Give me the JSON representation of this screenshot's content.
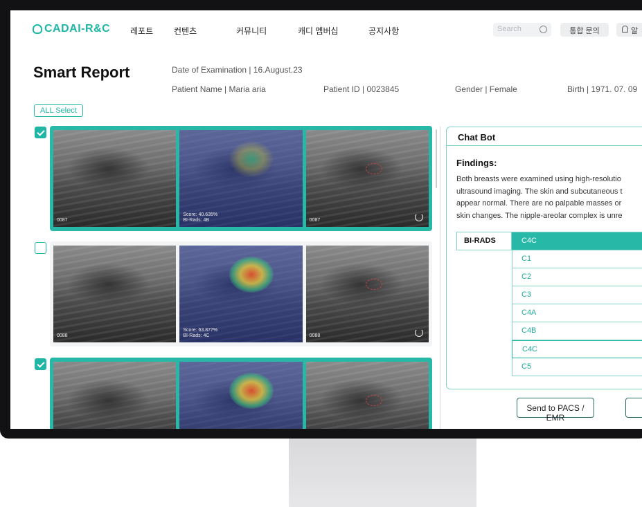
{
  "header": {
    "logo": "CADAI-R&C",
    "nav": [
      "레포트",
      "컨텐츠",
      "커뮤니티",
      "캐디 멤버십",
      "공지사항"
    ],
    "search_placeholder": "Search",
    "inquiry": "통합 문의",
    "alarm": "알"
  },
  "report": {
    "title": "Smart Report",
    "exam_date": "Date of Examination  |  16.August.23",
    "patient_name": "Patient Name  |  Maria aria",
    "patient_id": "Patient ID  |  0023845",
    "gender": "Gender  |  Female",
    "birth": "Birth  |  1971. 07. 09",
    "all_select": "ALL Select"
  },
  "rows": [
    {
      "selected": true,
      "labels": [
        "0087",
        "Score: 40.635%\nBI-Rads: 4B",
        "0087"
      ]
    },
    {
      "selected": false,
      "labels": [
        "0088",
        "Score: 63.877%\nBI-Rads: 4C",
        "0088"
      ]
    },
    {
      "selected": true,
      "labels": [
        "",
        "",
        ""
      ]
    }
  ],
  "chat": {
    "title": "Chat Bot",
    "findings_title": "Findings:",
    "findings_lines": [
      "Both breasts were examined using high-resolutio",
      "ultrasound imaging. The skin and subcutaneous t",
      "appear normal. There are no palpable masses or",
      "skin changes. The nipple-areolar complex is unre"
    ],
    "birads_label": "BI-RADS",
    "birads_selected": "C4C",
    "birads_options": [
      "C1",
      "C2",
      "C3",
      "C4A",
      "C4B",
      "C4C",
      "C5"
    ]
  },
  "actions": {
    "send": "Send to PACS / EMR"
  },
  "colors": {
    "accent": "#20b6a6",
    "bezel": "#121214"
  }
}
